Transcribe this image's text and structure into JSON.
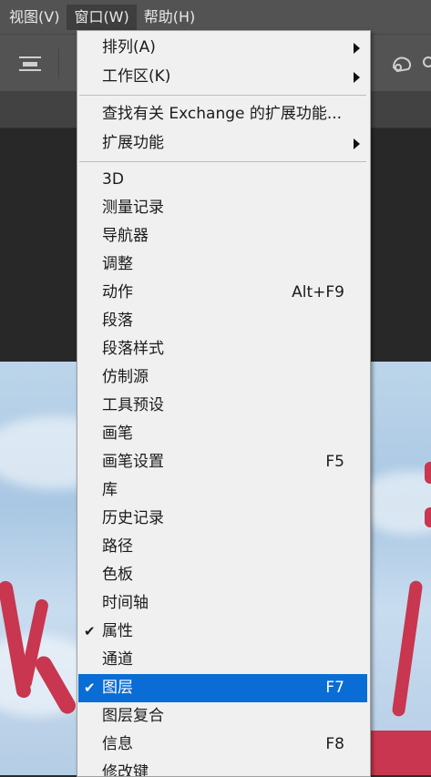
{
  "menubar": [
    {
      "label": "视图(V)"
    },
    {
      "label": "窗口(W)",
      "active": true
    },
    {
      "label": "帮助(H)"
    }
  ],
  "window_menu": {
    "groups": [
      [
        {
          "label": "排列(A)",
          "submenu": true
        },
        {
          "label": "工作区(K)",
          "submenu": true
        }
      ],
      [
        {
          "label": "查找有关 Exchange 的扩展功能..."
        },
        {
          "label": "扩展功能",
          "submenu": true
        }
      ],
      [
        {
          "label": "3D"
        },
        {
          "label": "测量记录"
        },
        {
          "label": "导航器"
        },
        {
          "label": "调整"
        },
        {
          "label": "动作",
          "shortcut": "Alt+F9"
        },
        {
          "label": "段落"
        },
        {
          "label": "段落样式"
        },
        {
          "label": "仿制源"
        },
        {
          "label": "工具预设"
        },
        {
          "label": "画笔"
        },
        {
          "label": "画笔设置",
          "shortcut": "F5"
        },
        {
          "label": "库"
        },
        {
          "label": "历史记录"
        },
        {
          "label": "路径"
        },
        {
          "label": "色板"
        },
        {
          "label": "时间轴"
        },
        {
          "label": "属性",
          "checked": true
        },
        {
          "label": "通道"
        },
        {
          "label": "图层",
          "shortcut": "F7",
          "checked": true,
          "highlighted": true
        },
        {
          "label": "图层复合"
        },
        {
          "label": "信息",
          "shortcut": "F8"
        },
        {
          "label": "修改键"
        }
      ]
    ],
    "check_glyph": "✔"
  },
  "colors": {
    "menubar_bg": "#535353",
    "menu_bg": "#f0f0f0",
    "highlight": "#0a6cd5",
    "canvas_stroke": "#c8364f"
  }
}
